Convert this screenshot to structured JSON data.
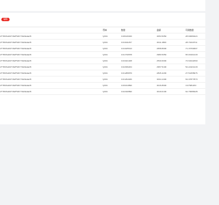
{
  "tag": {
    "label": "编辑"
  },
  "table": {
    "headers": [
      "",
      "币种",
      "数量",
      "金额",
      "可用数量"
    ],
    "rows": [
      [
        "27TR9SdZ4T4WPWF7XEKEda28",
        "fy001",
        "0.08416020",
        "3053.5050",
        "28.90080224"
      ],
      [
        "27TR9SdZ4T4WPWF7XEKEda28",
        "fy001",
        "0.04011257",
        "3011.4800",
        "28.70440711"
      ],
      [
        "27TR9SdZ4T4WPWF7XEKEda28",
        "fy001",
        "0.04425613",
        "2658.8900",
        "71.15790607"
      ],
      [
        "27TR9SdZ4T4WPWF7XEKEda28",
        "fy001",
        "0.01730878",
        "2980.5050",
        "65.00191418"
      ],
      [
        "27TR9SdZ4T4WPWF7XEKEda28",
        "fy001",
        "0.03421408",
        "2530.6000",
        "74.63242090"
      ],
      [
        "27TR9SdZ4T4WPWF7XEKEda28",
        "fy001",
        "0.02036204",
        "2957.5100",
        "54.22421218"
      ],
      [
        "27TR9SdZ4T4WPWF7XEKEda28",
        "fy001",
        "0.01289879",
        "2845.4200",
        "27.54258976"
      ],
      [
        "27TR9SdZ4T4WPWF7XEKEda28",
        "fy001",
        "0.01294466",
        "3034.1300",
        "63.37877870"
      ],
      [
        "27TR9SdZ4T4WPWF7XEKEda28",
        "fy001",
        "0.06314890",
        "3016.8900",
        "3.07681183"
      ],
      [
        "27TR9SdZ4T4WPWF7XEKEda28",
        "fy001",
        "0.02430890",
        "3019.0100",
        "62.79088428"
      ]
    ]
  }
}
